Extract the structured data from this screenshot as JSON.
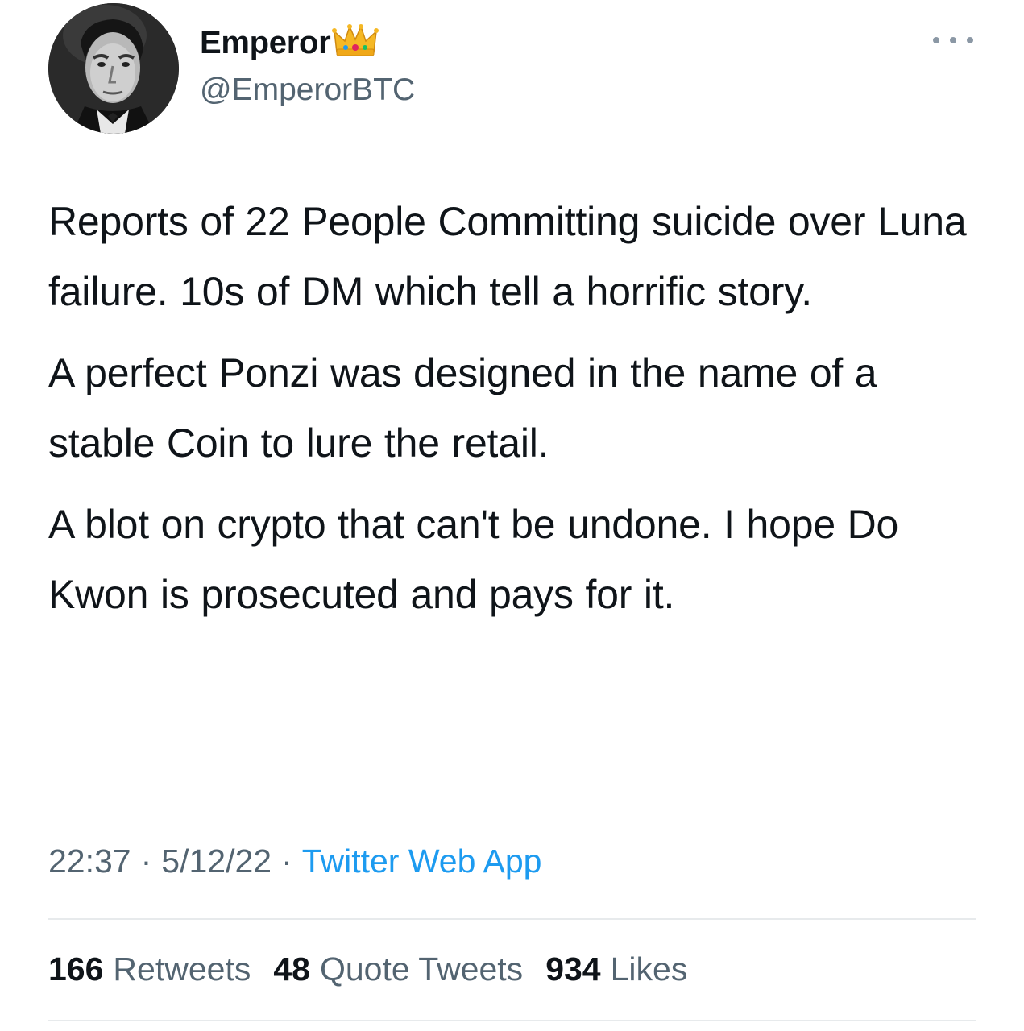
{
  "author": {
    "display_name": "Emperor",
    "handle": "@EmperorBTC",
    "badge_icon": "crown-icon",
    "avatar": "portrait-avatar"
  },
  "menu_icon": "more-dots-icon",
  "tweet": {
    "paragraphs": [
      "Reports of 22 People Committing suicide over Luna failure. 10s of DM which tell a horrific story.",
      "A perfect Ponzi was designed in the name of a stable Coin to lure the retail.",
      "A blot on crypto that can't be undone. I hope Do Kwon is prosecuted and pays for it."
    ]
  },
  "meta": {
    "time": "22:37",
    "date": "5/12/22",
    "separator": "·",
    "source": "Twitter Web App"
  },
  "stats": {
    "retweets": {
      "count": "166",
      "label": "Retweets"
    },
    "quotes": {
      "count": "48",
      "label": "Quote Tweets"
    },
    "likes": {
      "count": "934",
      "label": "Likes"
    }
  },
  "colors": {
    "text": "#0f1419",
    "secondary": "#536471",
    "link": "#1d9bf0",
    "divider": "#e7eaec"
  }
}
